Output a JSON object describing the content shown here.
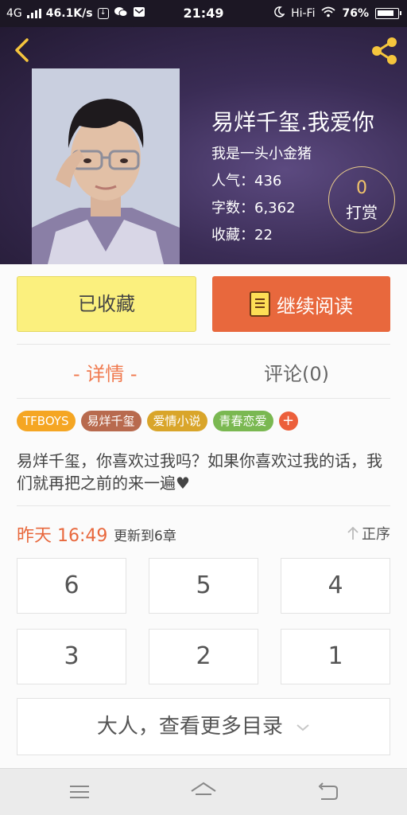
{
  "status_bar": {
    "network": "4G",
    "speed": "46.1K/s",
    "time": "21:49",
    "wifi_label": "Hi-Fi",
    "battery": "76%"
  },
  "book": {
    "title": "易烊千玺.我爱你",
    "author": "我是一头小金猪",
    "popularity": "人气：436",
    "words": "字数：6,362",
    "favorites": "收藏：22",
    "tip_count": "0",
    "tip_label": "打赏"
  },
  "actions": {
    "favorited_label": "已收藏",
    "continue_label": "继续阅读"
  },
  "tabs": {
    "detail": "- 详情 -",
    "comments": "评论(0)"
  },
  "tags": [
    {
      "label": "TFBOYS",
      "color": "#f5a623"
    },
    {
      "label": "易烊千玺",
      "color": "#b86a4e"
    },
    {
      "label": "爱情小说",
      "color": "#d9a52a"
    },
    {
      "label": "青春恋爱",
      "color": "#7ab851"
    }
  ],
  "tag_add": "+",
  "description": "易烊千玺，你喜欢过我吗？如果你喜欢过我的话，我们就再把之前的来一遍♥",
  "update": {
    "time": "昨天 16:49",
    "text": "更新到6章",
    "sort_label": "正序"
  },
  "chapters": [
    "6",
    "5",
    "4",
    "3",
    "2",
    "1"
  ],
  "more_label": "大人，查看更多目录",
  "colors": {
    "accent": "#e8683d",
    "favorite_bg": "#fbf07e",
    "share_icon": "#f5c53d"
  }
}
